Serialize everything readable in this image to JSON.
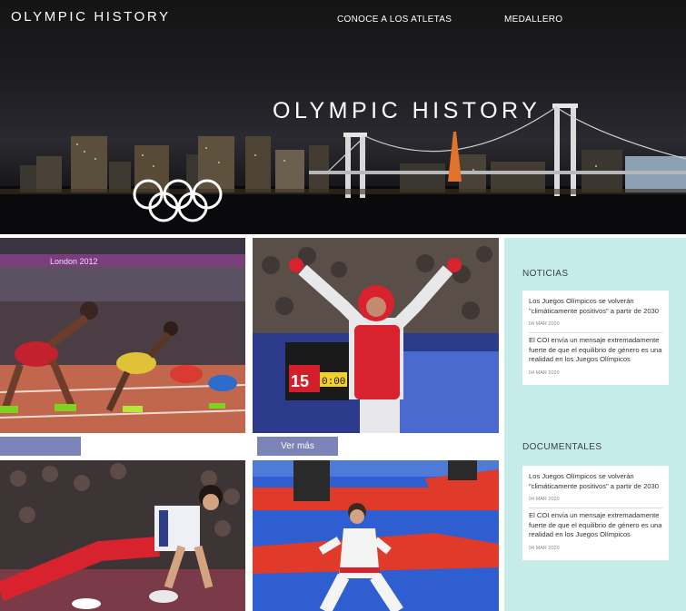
{
  "header": {
    "brand": "OLYMPIC HISTORY",
    "nav": [
      {
        "label": "CONOCE A LOS ATLETAS"
      },
      {
        "label": "MEDALLERO"
      }
    ],
    "hero_title": "OLYMPIC HISTORY"
  },
  "hero_photo": {
    "sign_text": "London 2012"
  },
  "gallery": {
    "button_label": "Ver más",
    "scoreboard_score": "15",
    "scoreboard_time": "0:00"
  },
  "sidebar": {
    "noticias": {
      "title": "NOTICIAS",
      "items": [
        {
          "title": "Los Juegos Olímpicos se volverán \"climáticamente positivos\" a partir de 2030",
          "date": "04 MAR 2020"
        },
        {
          "title": "El COI envía un mensaje extremadamente fuerte de que el equilibrio de género es una realidad en los Juegos Olímpicos",
          "date": "04 MAR 2020"
        }
      ]
    },
    "documentales": {
      "title": "DOCUMENTALES",
      "items": [
        {
          "title": "Los Juegos Olímpicos se volverán \"climáticamente positivos\" a partir de 2030",
          "date": "04 MAR 2020"
        },
        {
          "title": "El COI envía un mensaje extremadamente fuerte de que el equilibrio de género es una realidad en los Juegos Olímpicos",
          "date": "04 MAR 2020"
        }
      ]
    }
  },
  "colors": {
    "button": "#7b83b7",
    "sidebar_bg": "#c6ecea"
  }
}
